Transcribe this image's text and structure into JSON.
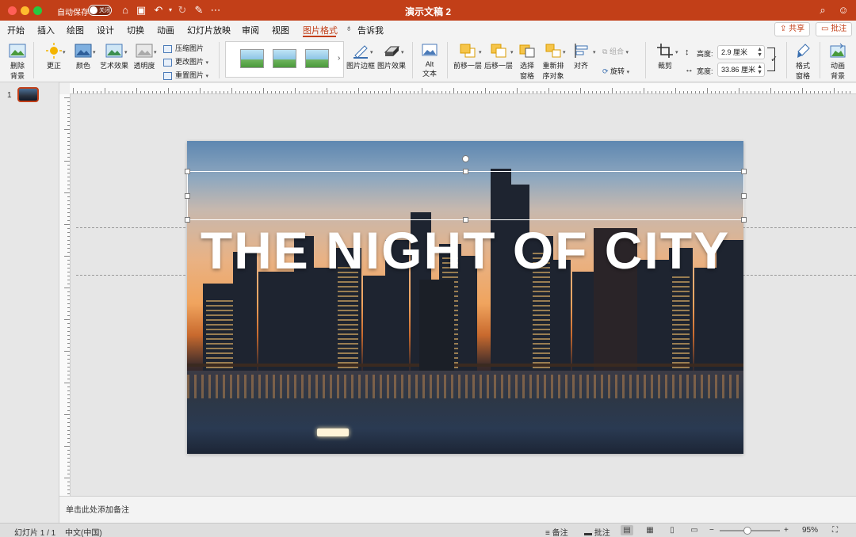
{
  "window": {
    "title": "演示文稿 2",
    "autosave_label": "自动保存",
    "autosave_state": "关闭"
  },
  "menu": {
    "tabs": [
      "开始",
      "插入",
      "绘图",
      "设计",
      "切换",
      "动画",
      "幻灯片放映",
      "审阅",
      "视图",
      "图片格式"
    ],
    "tell_me": "告诉我",
    "share": "共享",
    "comments": "批注"
  },
  "ribbon": {
    "remove_bg": [
      "删除",
      "背景"
    ],
    "corrections": "更正",
    "color": "颜色",
    "artistic": "艺术效果",
    "transparency": "透明度",
    "compress": "压缩图片",
    "change": "更改图片",
    "reset": "重置图片",
    "border": "图片边框",
    "effects": "图片效果",
    "alt": [
      "Alt",
      "文本"
    ],
    "bring_forward": "前移一层",
    "send_backward": "后移一层",
    "selection_pane": [
      "选择",
      "窗格"
    ],
    "reorder": [
      "重新排",
      "序对象"
    ],
    "align": "对齐",
    "group": "组合",
    "rotate": "旋转",
    "crop": "裁剪",
    "height_label": "高度:",
    "height_value": "2.9 厘米",
    "width_label": "宽度:",
    "width_value": "33.86 厘米",
    "format_pane": [
      "格式",
      "窗格"
    ],
    "animate_bg": [
      "动画",
      "背景"
    ]
  },
  "sidebar": {
    "slide_number": "1"
  },
  "slide": {
    "title": "THE NIGHT OF CITY"
  },
  "notes": {
    "placeholder": "单击此处添加备注"
  },
  "status": {
    "slide_info": "幻灯片 1 / 1",
    "language": "中文(中国)",
    "notes": "备注",
    "comments": "批注",
    "zoom": "95%"
  },
  "colors": {
    "accent": "#c23f18"
  }
}
